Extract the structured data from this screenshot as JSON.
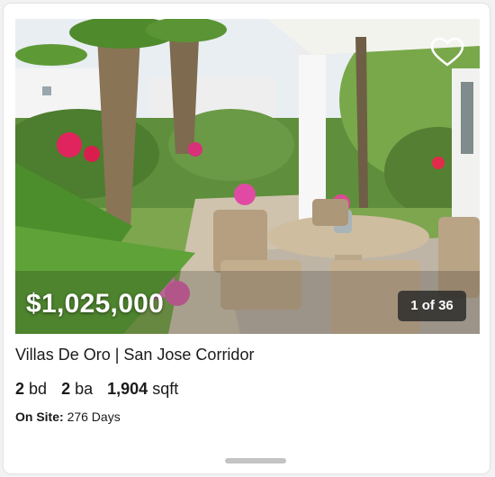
{
  "listing": {
    "price": "$1,025,000",
    "photo_counter": "1 of 36",
    "title": "Villas De Oro | San Jose Corridor",
    "beds_value": "2",
    "beds_unit": "bd",
    "baths_value": "2",
    "baths_unit": "ba",
    "sqft_value": "1,904",
    "sqft_unit": "sqft",
    "on_site_label": "On Site:",
    "on_site_value": "276 Days"
  },
  "icons": {
    "favorite": "heart-outline-icon",
    "scroll_handle": "drag-handle"
  },
  "colors": {
    "price_text": "#ffffff",
    "counter_bg": "#2b2b2b",
    "body_text": "#1a1a1a"
  }
}
